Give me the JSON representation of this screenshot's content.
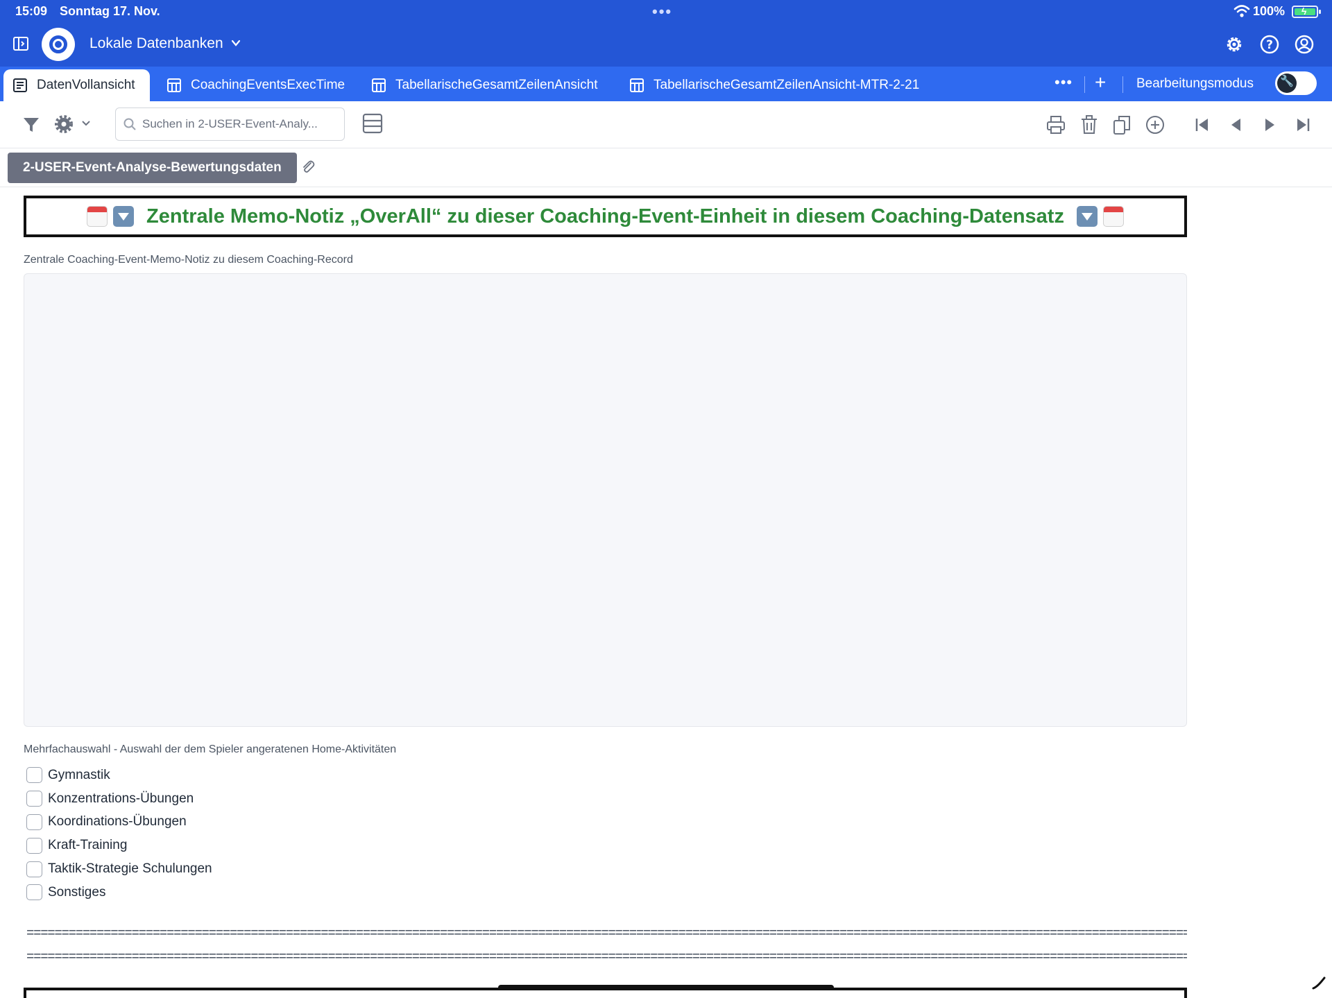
{
  "status_bar": {
    "time": "15:09",
    "date": "Sonntag 17. Nov.",
    "battery": "100%"
  },
  "nav": {
    "db_title": "Lokale Datenbanken"
  },
  "tabs": [
    {
      "label": "DatenVollansicht",
      "active": true
    },
    {
      "label": "CoachingEventsExecTime",
      "active": false
    },
    {
      "label": "TabellarischeGesamtZeilenAnsicht",
      "active": false
    },
    {
      "label": "TabellarischeGesamtZeilenAnsicht-MTR-2-21",
      "active": false
    }
  ],
  "tabbar": {
    "more": "•••",
    "add": "+",
    "edit_mode_label": "Bearbeitungsmodus"
  },
  "toolbar": {
    "search_placeholder": "Suchen in 2-USER-Event-Analy..."
  },
  "table_chip": "2-USER-Event-Analyse-Bewertungsdaten",
  "banner": {
    "text": "Zentrale Memo-Notiz „OverAll“ zu dieser Coaching-Event-Einheit  in diesem Coaching-Datensatz"
  },
  "memo_field": {
    "label": "Zentrale Coaching-Event-Memo-Notiz zu diesem Coaching-Record",
    "value": ""
  },
  "multi_select": {
    "label": "Mehrfachauswahl - Auswahl der dem Spieler angeratenen Home-Aktivitäten",
    "options": [
      {
        "label": "Gymnastik",
        "checked": false
      },
      {
        "label": "Konzentrations-Übungen",
        "checked": false
      },
      {
        "label": "Koordinations-Übungen",
        "checked": false
      },
      {
        "label": "Kraft-Training",
        "checked": false
      },
      {
        "label": "Taktik-Strategie Schulungen",
        "checked": false
      },
      {
        "label": "Sonstiges",
        "checked": false
      }
    ]
  },
  "separator_lines": [
    "=========================================================================================================================================================================================",
    "========================================================================================================================================================================================="
  ],
  "colors": {
    "header_blue": "#2456d6",
    "tab_blue": "#2f6af0",
    "banner_green": "#2e8a3a",
    "chip_gray": "#6b7080"
  }
}
